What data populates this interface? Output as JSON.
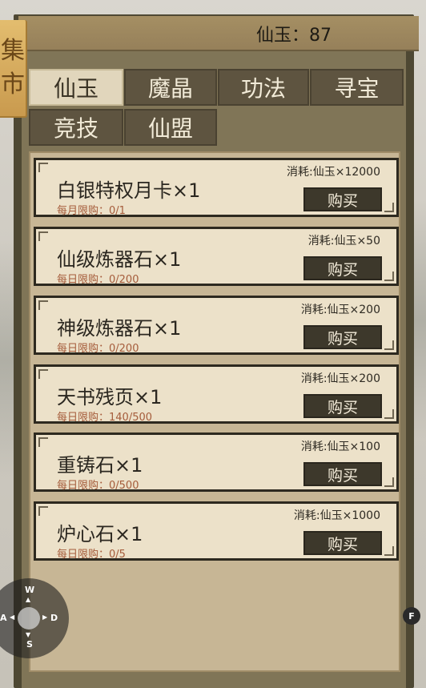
{
  "header": {
    "currency_text": "仙玉：87"
  },
  "market_tag": {
    "char_1": "集",
    "char_2": "市"
  },
  "tabs": [
    {
      "label": "仙玉",
      "active": true
    },
    {
      "label": "魔晶",
      "active": false
    },
    {
      "label": "功法",
      "active": false
    },
    {
      "label": "寻宝",
      "active": false
    },
    {
      "label": "竞技",
      "active": false
    },
    {
      "label": "仙盟",
      "active": false
    }
  ],
  "items": [
    {
      "name": "白银特权月卡×1",
      "limit": "每月限购：0/1",
      "cost": "消耗:仙玉×12000",
      "button": "购买"
    },
    {
      "name": "仙级炼器石×1",
      "limit": "每日限购：0/200",
      "cost": "消耗:仙玉×50",
      "button": "购买"
    },
    {
      "name": "神级炼器石×1",
      "limit": "每日限购：0/200",
      "cost": "消耗:仙玉×200",
      "button": "购买"
    },
    {
      "name": "天书残页×1",
      "limit": "每日限购：140/500",
      "cost": "消耗:仙玉×200",
      "button": "购买"
    },
    {
      "name": "重铸石×1",
      "limit": "每日限购：0/500",
      "cost": "消耗:仙玉×100",
      "button": "购买"
    },
    {
      "name": "炉心石×1",
      "limit": "每日限购：0/5",
      "cost": "消耗:仙玉×1000",
      "button": "购买"
    }
  ],
  "controls": {
    "up": "W",
    "left": "A",
    "right": "D",
    "down": "S",
    "action": "F"
  },
  "colors": {
    "active_tab": "#e1d6bc",
    "inactive_tab": "#5e5440",
    "limit_text": "#a55c3b",
    "buy_button": "#3d382b"
  }
}
